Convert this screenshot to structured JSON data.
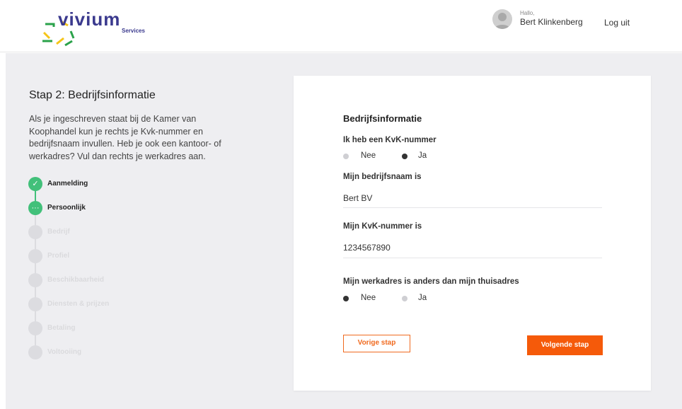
{
  "header": {
    "logo_word": "vivium",
    "logo_sub": "Services",
    "greeting": "Hallo,",
    "user_name": "Bert Klinkenberg",
    "logout_label": "Log uit"
  },
  "intro": {
    "title": "Stap 2: Bedrijfsinformatie",
    "description": "Als je ingeschreven staat bij de Kamer van Koophandel kun je rechts je Kvk-nummer en bedrijfsnaam invullen. Heb je ook een kantoor- of werkadres? Vul dan rechts je werkadres aan."
  },
  "steps": [
    {
      "label": "Aanmelding",
      "state": "done"
    },
    {
      "label": "Persoonlijk",
      "state": "current"
    },
    {
      "label": "Bedrijf",
      "state": "todo"
    },
    {
      "label": "Profiel",
      "state": "todo"
    },
    {
      "label": "Beschikbaarheid",
      "state": "todo"
    },
    {
      "label": "Diensten & prijzen",
      "state": "todo"
    },
    {
      "label": "Betaling",
      "state": "todo"
    },
    {
      "label": "Voltooiing",
      "state": "todo"
    }
  ],
  "form": {
    "title": "Bedrijfsinformatie",
    "kvk_question": "Ik heb een KvK-nummer",
    "kvk_options": [
      {
        "label": "Nee",
        "selected": false
      },
      {
        "label": "Ja",
        "selected": true
      }
    ],
    "company_name_label": "Mijn bedrijfsnaam is",
    "company_name_value": "Bert BV",
    "kvk_number_label": "Mijn KvK-nummer is",
    "kvk_number_value": "1234567890",
    "workaddress_question": "Mijn werkadres is anders dan mijn thuisadres",
    "workaddress_options": [
      {
        "label": "Nee",
        "selected": true
      },
      {
        "label": "Ja",
        "selected": false
      }
    ],
    "prev_label": "Vorige stap",
    "next_label": "Volgende stap"
  },
  "colors": {
    "accent": "#f55a0a",
    "success": "#42c07a",
    "brand": "#3b3a8e"
  }
}
